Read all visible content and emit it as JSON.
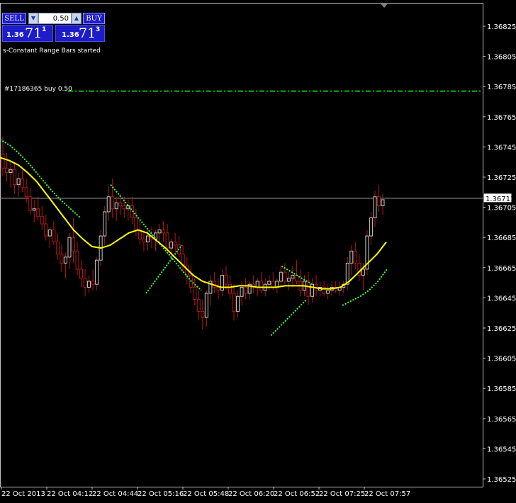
{
  "trade_panel": {
    "sell_label": "SELL",
    "buy_label": "BUY",
    "lot_value": "0.50",
    "sell_price": {
      "prefix": "1.36",
      "big": "71",
      "sup": "1"
    },
    "buy_price": {
      "prefix": "1.36",
      "big": "71",
      "sup": "3"
    }
  },
  "messages": {
    "status": "s-Constant Range Bars started",
    "order_label": "#17186365 buy 0.50"
  },
  "colors": {
    "background": "#000000",
    "candle": "#b01818",
    "ma_yellow": "#ffff00",
    "envelope_green": "#40ff40",
    "grid_axis": "#c0c0c0",
    "order_line": "#00c000"
  },
  "chart_data": {
    "type": "candlestick",
    "ylim": [
      1.3652,
      1.3684
    ],
    "y_ticks": [
      "1.36825",
      "1.36805",
      "1.36785",
      "1.36765",
      "1.36745",
      "1.36725",
      "1.36705",
      "1.36685",
      "1.36665",
      "1.36645",
      "1.36625",
      "1.36605",
      "1.36585",
      "1.36565",
      "1.36545",
      "1.36525"
    ],
    "x_ticks": [
      "22 Oct 2013",
      "22 Oct 04:12",
      "22 Oct 04:44",
      "22 Oct 05:16",
      "22 Oct 05:48",
      "22 Oct 06:20",
      "22 Oct 06:52",
      "22 Oct 07:25",
      "22 Oct 07:57"
    ],
    "current_price": "1.36711",
    "order_price": 1.36782,
    "candles": [
      [
        1.3674,
        1.36752,
        1.36726,
        1.36731
      ],
      [
        1.36731,
        1.36741,
        1.36722,
        1.36728
      ],
      [
        1.36728,
        1.36736,
        1.36718,
        1.3673
      ],
      [
        1.3673,
        1.36735,
        1.36714,
        1.3672
      ],
      [
        1.3672,
        1.36728,
        1.36712,
        1.36724
      ],
      [
        1.36724,
        1.3673,
        1.36715,
        1.36718
      ],
      [
        1.36718,
        1.36724,
        1.36708,
        1.36712
      ],
      [
        1.36712,
        1.36718,
        1.367,
        1.36703
      ],
      [
        1.36703,
        1.3671,
        1.36695,
        1.36704
      ],
      [
        1.36704,
        1.36712,
        1.36696,
        1.36699
      ],
      [
        1.36699,
        1.36706,
        1.3669,
        1.36694
      ],
      [
        1.36694,
        1.367,
        1.36683,
        1.36686
      ],
      [
        1.36686,
        1.36692,
        1.36678,
        1.3669
      ],
      [
        1.3669,
        1.36696,
        1.3668,
        1.36682
      ],
      [
        1.36682,
        1.36688,
        1.3667,
        1.36674
      ],
      [
        1.36674,
        1.3668,
        1.36662,
        1.36668
      ],
      [
        1.36668,
        1.36675,
        1.36658,
        1.36672
      ],
      [
        1.36672,
        1.36688,
        1.36664,
        1.36685
      ],
      [
        1.36685,
        1.36698,
        1.36668,
        1.36676
      ],
      [
        1.36676,
        1.36682,
        1.3666,
        1.36664
      ],
      [
        1.36664,
        1.3667,
        1.36652,
        1.36658
      ],
      [
        1.36658,
        1.36664,
        1.36646,
        1.36652
      ],
      [
        1.36652,
        1.3666,
        1.36648,
        1.36656
      ],
      [
        1.36656,
        1.36664,
        1.3665,
        1.36654
      ],
      [
        1.36654,
        1.36672,
        1.3665,
        1.3667
      ],
      [
        1.3667,
        1.3669,
        1.36666,
        1.36686
      ],
      [
        1.36686,
        1.36706,
        1.3668,
        1.36702
      ],
      [
        1.36702,
        1.3672,
        1.36696,
        1.36712
      ],
      [
        1.36712,
        1.36724,
        1.36698,
        1.36704
      ],
      [
        1.36704,
        1.36712,
        1.36696,
        1.36708
      ],
      [
        1.36708,
        1.36714,
        1.367,
        1.36706
      ],
      [
        1.36706,
        1.36712,
        1.36698,
        1.36704
      ],
      [
        1.36704,
        1.3671,
        1.36696,
        1.36706
      ],
      [
        1.36706,
        1.36712,
        1.36694,
        1.36698
      ],
      [
        1.36698,
        1.36704,
        1.36686,
        1.3669
      ],
      [
        1.3669,
        1.36696,
        1.3668,
        1.36684
      ],
      [
        1.36684,
        1.3669,
        1.36676,
        1.36682
      ],
      [
        1.36682,
        1.3669,
        1.36676,
        1.36686
      ],
      [
        1.36686,
        1.36692,
        1.36678,
        1.36684
      ],
      [
        1.36684,
        1.3669,
        1.36676,
        1.36688
      ],
      [
        1.36688,
        1.36694,
        1.3668,
        1.3669
      ],
      [
        1.3669,
        1.36696,
        1.36682,
        1.36688
      ],
      [
        1.36688,
        1.36694,
        1.36674,
        1.36678
      ],
      [
        1.36678,
        1.36684,
        1.3667,
        1.36682
      ],
      [
        1.36682,
        1.36688,
        1.36674,
        1.3668
      ],
      [
        1.3668,
        1.36686,
        1.36672,
        1.36674
      ],
      [
        1.36674,
        1.3668,
        1.36662,
        1.36666
      ],
      [
        1.36666,
        1.36672,
        1.36654,
        1.3666
      ],
      [
        1.3666,
        1.36666,
        1.36648,
        1.36652
      ],
      [
        1.36652,
        1.36658,
        1.3664,
        1.36644
      ],
      [
        1.36644,
        1.3665,
        1.3663,
        1.36636
      ],
      [
        1.36636,
        1.36644,
        1.36624,
        1.36632
      ],
      [
        1.36632,
        1.3665,
        1.36626,
        1.36648
      ],
      [
        1.36648,
        1.3666,
        1.3664,
        1.36656
      ],
      [
        1.36656,
        1.36662,
        1.36648,
        1.36652
      ],
      [
        1.36652,
        1.36658,
        1.36644,
        1.3665
      ],
      [
        1.3665,
        1.36664,
        1.36646,
        1.3666
      ],
      [
        1.3666,
        1.36666,
        1.3665,
        1.36654
      ],
      [
        1.36654,
        1.3666,
        1.36644,
        1.36648
      ],
      [
        1.36648,
        1.36654,
        1.3663,
        1.36636
      ],
      [
        1.36636,
        1.3665,
        1.36632,
        1.36646
      ],
      [
        1.36646,
        1.36656,
        1.3664,
        1.36652
      ],
      [
        1.36652,
        1.36658,
        1.36644,
        1.36648
      ],
      [
        1.36648,
        1.36656,
        1.36644,
        1.36654
      ],
      [
        1.36654,
        1.3666,
        1.36648,
        1.36652
      ],
      [
        1.36652,
        1.36658,
        1.36646,
        1.36656
      ],
      [
        1.36656,
        1.36662,
        1.36648,
        1.3665
      ],
      [
        1.3665,
        1.36658,
        1.36646,
        1.36654
      ],
      [
        1.36654,
        1.3666,
        1.3665,
        1.36656
      ],
      [
        1.36656,
        1.36662,
        1.3665,
        1.36652
      ],
      [
        1.36652,
        1.36658,
        1.36648,
        1.36656
      ],
      [
        1.36656,
        1.36666,
        1.36652,
        1.36662
      ],
      [
        1.36662,
        1.36668,
        1.36654,
        1.36656
      ],
      [
        1.36656,
        1.36662,
        1.3665,
        1.36658
      ],
      [
        1.36658,
        1.36666,
        1.36652,
        1.3666
      ],
      [
        1.3666,
        1.3667,
        1.36654,
        1.36656
      ],
      [
        1.36656,
        1.36664,
        1.36646,
        1.3665
      ],
      [
        1.3665,
        1.3666,
        1.36646,
        1.36656
      ],
      [
        1.36656,
        1.36662,
        1.3664,
        1.36646
      ],
      [
        1.36646,
        1.36658,
        1.36642,
        1.36654
      ],
      [
        1.36654,
        1.3666,
        1.36646,
        1.3665
      ],
      [
        1.3665,
        1.36656,
        1.36646,
        1.36652
      ],
      [
        1.36652,
        1.36656,
        1.36646,
        1.36648
      ],
      [
        1.36648,
        1.36654,
        1.36644,
        1.3665
      ],
      [
        1.3665,
        1.36656,
        1.36646,
        1.36652
      ],
      [
        1.36652,
        1.36656,
        1.36648,
        1.3665
      ],
      [
        1.3665,
        1.36656,
        1.36646,
        1.36652
      ],
      [
        1.36652,
        1.36656,
        1.36648,
        1.36654
      ],
      [
        1.36654,
        1.36672,
        1.3665,
        1.36668
      ],
      [
        1.36668,
        1.3668,
        1.3666,
        1.36676
      ],
      [
        1.36676,
        1.36682,
        1.36664,
        1.36668
      ],
      [
        1.36668,
        1.36674,
        1.36656,
        1.3666
      ],
      [
        1.3666,
        1.36668,
        1.3665,
        1.36664
      ],
      [
        1.36664,
        1.3669,
        1.3666,
        1.36686
      ],
      [
        1.36686,
        1.36702,
        1.3668,
        1.36698
      ],
      [
        1.36698,
        1.36716,
        1.36692,
        1.36712
      ],
      [
        1.36712,
        1.3672,
        1.36702,
        1.36706
      ],
      [
        1.36706,
        1.36714,
        1.367,
        1.3671
      ]
    ],
    "ma_yellow": [
      1.36738,
      1.36736,
      1.36733,
      1.36728,
      1.36722,
      1.36714,
      1.36706,
      1.36698,
      1.3669,
      1.36684,
      1.36679,
      1.36678,
      1.3668,
      1.36684,
      1.36688,
      1.3669,
      1.36688,
      1.36683,
      1.36678,
      1.36672,
      1.36666,
      1.3666,
      1.36656,
      1.36654,
      1.36652,
      1.36652,
      1.36653,
      1.36653,
      1.36652,
      1.36652,
      1.36652,
      1.36653,
      1.36653,
      1.36653,
      1.36652,
      1.36651,
      1.36651,
      1.36652,
      1.36656,
      1.36662,
      1.36668,
      1.36674,
      1.36682
    ],
    "envelope_upper": [
      1.3675,
      1.36746,
      1.3674,
      1.36733,
      1.36725,
      1.36717,
      1.3671,
      1.36704,
      1.36698,
      null,
      null,
      1.3672,
      1.36712,
      1.36704,
      1.36696,
      1.36688,
      1.3668,
      1.36672,
      1.36664,
      1.36656,
      1.3665,
      null,
      null,
      null,
      null,
      null,
      null,
      null,
      1.36666,
      1.36662,
      1.36658,
      1.36654
    ],
    "envelope_lower": [
      null,
      null,
      null,
      null,
      null,
      null,
      null,
      1.36648,
      1.36656,
      1.36664,
      1.36672,
      1.3668,
      null,
      null,
      null,
      null,
      null,
      null,
      null,
      null,
      null,
      1.3662,
      1.36626,
      1.36632,
      1.36638,
      1.36644,
      null,
      null,
      null,
      1.3664,
      1.36643,
      1.36646,
      1.3665,
      1.36656,
      1.36664
    ]
  }
}
